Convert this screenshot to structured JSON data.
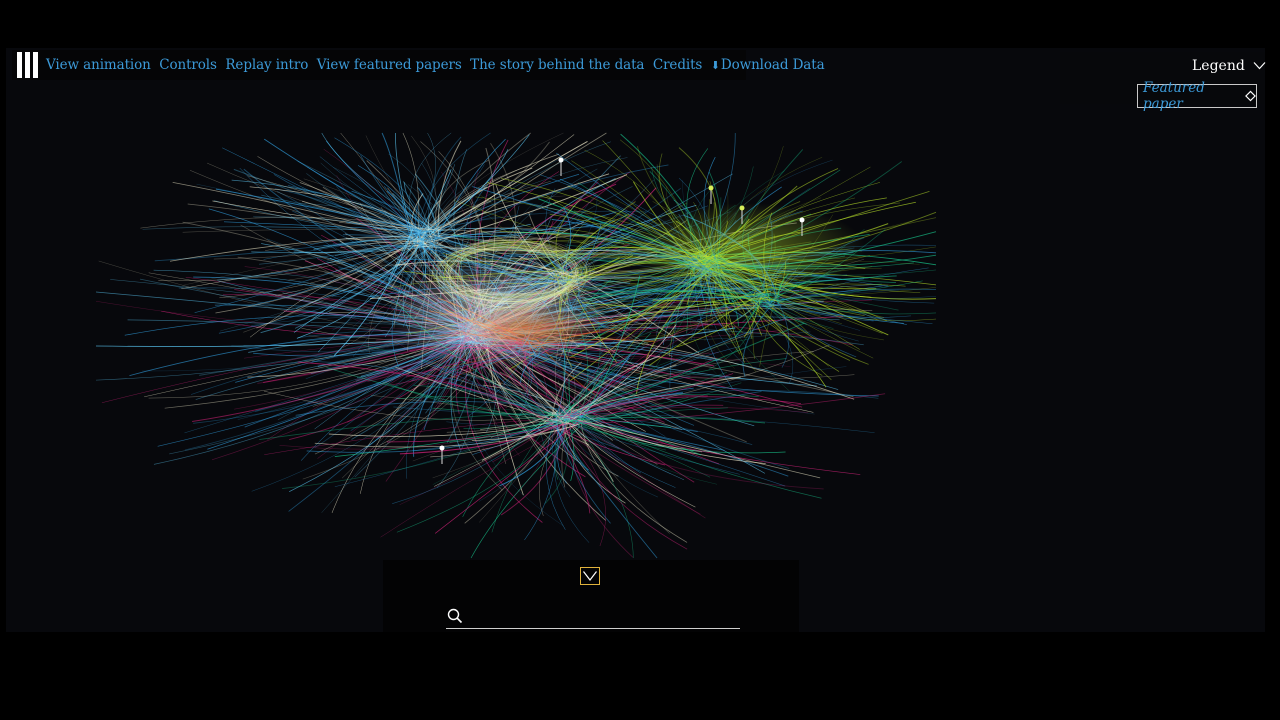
{
  "nav": {
    "links": [
      {
        "label": "View animation"
      },
      {
        "label": "Controls"
      },
      {
        "label": "Replay intro"
      },
      {
        "label": "View featured papers"
      },
      {
        "label": "The story behind the data"
      },
      {
        "label": "Credits"
      }
    ],
    "download_label": "Download Data",
    "download_icon": "download-arrow-icon"
  },
  "legend": {
    "label": "Legend",
    "featured_label": "Featured paper",
    "featured_icon": "diamond-icon"
  },
  "search": {
    "value": "",
    "placeholder": ""
  },
  "colors": {
    "link": "#3c9ad8",
    "accent_gold": "#e0b23c",
    "background": "#07080c",
    "cluster_colors": [
      "#2f9ad8",
      "#d1237a",
      "#b8e02a",
      "#e86a1a",
      "#18c28a",
      "#ece7c8",
      "#5fd0ff",
      "#ffffff"
    ]
  }
}
